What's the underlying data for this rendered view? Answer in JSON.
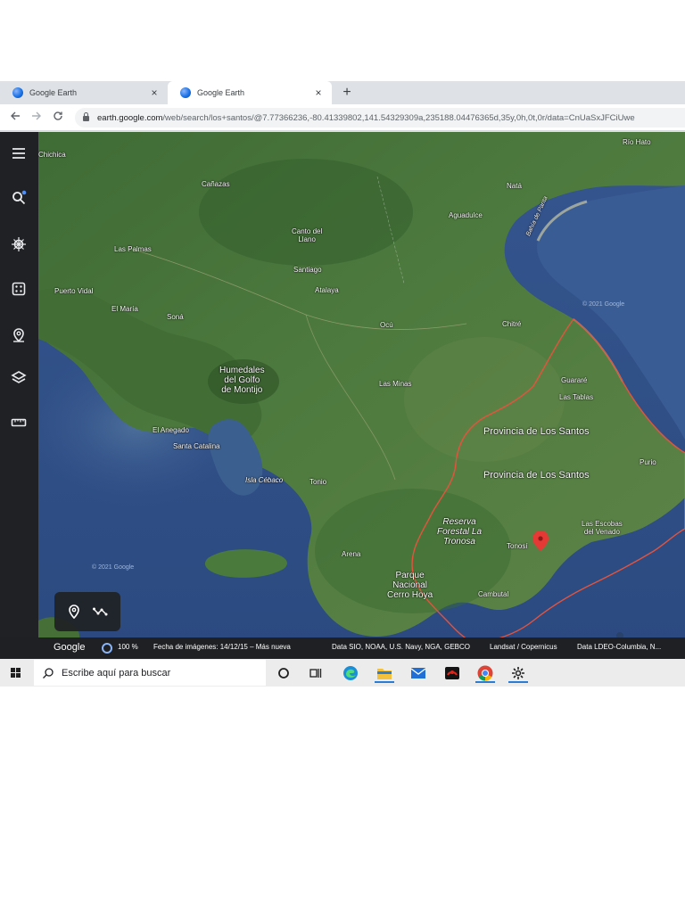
{
  "browser": {
    "tabs": [
      {
        "title": "Google Earth",
        "active": false
      },
      {
        "title": "Google Earth",
        "active": true
      }
    ],
    "new_tab_symbol": "+",
    "close_symbol": "×",
    "url_host": "earth.google.com",
    "url_path": "/web/search/los+santos/@7.77366236,-80.41339802,141.54329309a,235188.04476365d,35y,0h,0t,0r/data=CnUaSxJFCiUwe"
  },
  "earth_rail": {
    "icons": [
      "menu-icon",
      "search-icon",
      "voyager-icon",
      "feeling-lucky-icon",
      "projects-icon",
      "map-style-icon",
      "measure-icon"
    ]
  },
  "map": {
    "labels": {
      "rio_hato": "Río Hato",
      "chichica": "Chichica",
      "canazas": "Cañazas",
      "nata": "Natá",
      "aguadulce": "Aguadulce",
      "bahia_de_parita": "Bahía de Parita",
      "las_palmas": "Las Palmas",
      "canto_del_llano": "Canto del\nLlano",
      "santiago": "Santiago",
      "atalaya": "Atalaya",
      "puerto_vidal": "Puerto Vidal",
      "el_maria": "El María",
      "sona": "Soná",
      "ocu": "Ocú",
      "chitre": "Chitré",
      "humedales": "Humedales\ndel Golfo\nde Montijo",
      "las_minas": "Las Minas",
      "guarare": "Guararé",
      "las_tablas": "Las Tablas",
      "provincia_1": "Provincia de Los Santos",
      "provincia_2": "Provincia de Los Santos",
      "el_anegado": "El Anegado",
      "santa_catalina": "Santa Catalina",
      "pedasi": "Purio",
      "isla_cebaco": "Isla Cébaco",
      "tonio": "Tonio",
      "reserva": "Reserva\nForestal La\nTronosa",
      "tonosi": "Tonosí",
      "las_escobas": "Las Escobas\ndel Venado",
      "arena": "Arena",
      "parque": "Parque\nNacional\nCerro Hoya",
      "cambutal": "Cambutal",
      "watermark_1": "© 2021 Google",
      "watermark_2": "© 2021 Google"
    },
    "marker_color": "#e53935",
    "boundary_color": "#e5533d"
  },
  "status_bar": {
    "brand": "Google",
    "zoom": "100 %",
    "imagery_date": "Fecha de imágenes: 14/12/15 – Más nueva",
    "attribution_1": "Data SIO, NOAA, U.S. Navy, NGA, GEBCO",
    "attribution_2": "Landsat / Copernicus",
    "attribution_3": "Data LDEO-Columbia, N..."
  },
  "taskbar": {
    "search_placeholder": "Escribe aquí para buscar",
    "apps": [
      "cortana-icon",
      "task-view-icon",
      "edge-icon",
      "file-explorer-icon",
      "mail-icon",
      "game-app-icon",
      "chrome-icon",
      "settings-icon"
    ]
  }
}
